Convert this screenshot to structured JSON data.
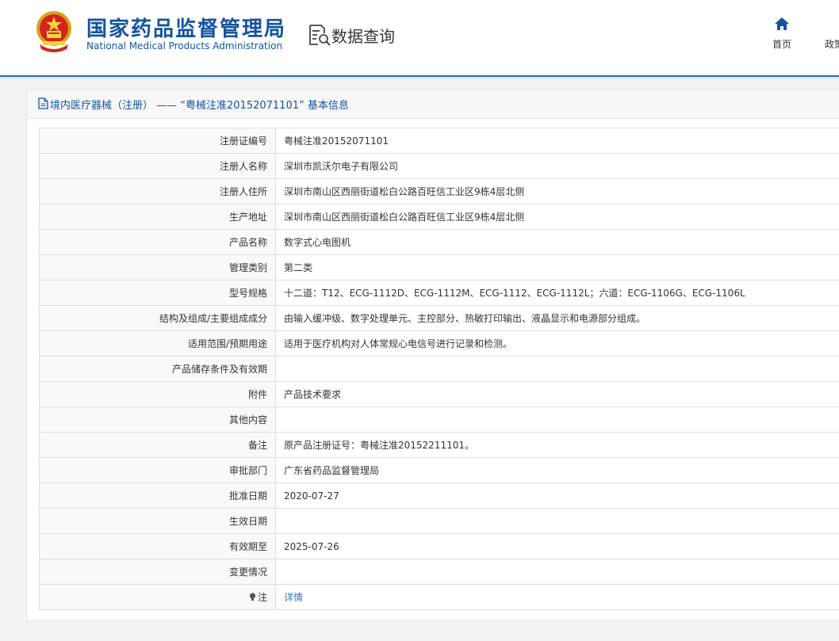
{
  "header": {
    "org_name_cn": "国家药品监督管理局",
    "org_name_en": "National Medical Products Administration",
    "section_title": "数据查询",
    "nav": [
      {
        "label": "首页",
        "icon": "home-icon"
      },
      {
        "label": "政策"
      }
    ]
  },
  "panel": {
    "title": "境内医疗器械（注册） —— “粤械注准20152071101” 基本信息",
    "rows": [
      {
        "label": "注册证编号",
        "value": "粤械注准20152071101"
      },
      {
        "label": "注册人名称",
        "value": "深圳市凯沃尔电子有限公司"
      },
      {
        "label": "注册人住所",
        "value": "深圳市南山区西丽街道松白公路百旺信工业区9栋4层北侧"
      },
      {
        "label": "生产地址",
        "value": "深圳市南山区西丽街道松白公路百旺信工业区9栋4层北侧"
      },
      {
        "label": "产品名称",
        "value": "数字式心电图机"
      },
      {
        "label": "管理类别",
        "value": "第二类"
      },
      {
        "label": "型号规格",
        "value": "十二道：T12、ECG-1112D、ECG-1112M、ECG-1112、ECG-1112L；六道：ECG-1106G、ECG-1106L"
      },
      {
        "label": "结构及组成/主要组成成分",
        "value": "由输入缓冲级、数字处理单元、主控部分、热敏打印输出、液晶显示和电源部分组成。"
      },
      {
        "label": "适用范围/预期用途",
        "value": "适用于医疗机构对人体常规心电信号进行记录和检测。"
      },
      {
        "label": "产品储存条件及有效期",
        "value": ""
      },
      {
        "label": "附件",
        "value": "产品技术要求"
      },
      {
        "label": "其他内容",
        "value": ""
      },
      {
        "label": "备注",
        "value": "原产品注册证号：粤械注准20152211101。"
      },
      {
        "label": "审批部门",
        "value": "广东省药品监督管理局"
      },
      {
        "label": "批准日期",
        "value": "2020-07-27"
      },
      {
        "label": "生效日期",
        "value": ""
      },
      {
        "label": "有效期至",
        "value": "2025-07-26"
      },
      {
        "label": "变更情况",
        "value": ""
      }
    ],
    "note_row": {
      "label": "注",
      "icon": "bulb-icon",
      "link_text": "详情"
    }
  }
}
